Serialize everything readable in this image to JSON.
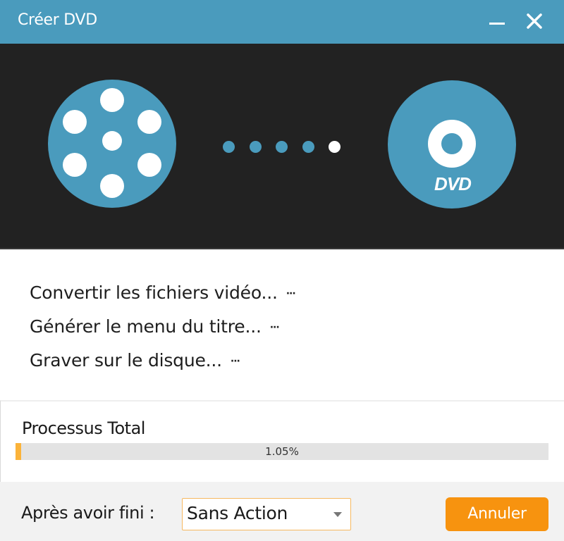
{
  "window": {
    "title": "Créer DVD",
    "controls": {
      "minimize_icon": "minimize-icon",
      "close_icon": "close-icon"
    }
  },
  "banner": {
    "source_icon": "film-reel-icon",
    "target_icon": "dvd-disc-icon",
    "target_icon_label": "DVD",
    "progress_dots": {
      "total": 5,
      "active_index": 4
    },
    "colors": {
      "accent": "#4a9bbd",
      "background": "#222222",
      "active_dot": "#ffffff"
    }
  },
  "steps": [
    {
      "label": "Convertir les fichiers vidéo...",
      "status": "···"
    },
    {
      "label": "Générer le menu du titre...",
      "status": "···"
    },
    {
      "label": "Graver sur le disque...",
      "status": "···"
    }
  ],
  "process": {
    "title": "Processus Total",
    "progress_percent": 1.05,
    "progress_text": "1.05%",
    "fill_color": "#fbb33a"
  },
  "footer": {
    "after_label": "Après avoir fini :",
    "after_select": {
      "value": "Sans Action"
    },
    "cancel_label": "Annuler",
    "cancel_color": "#f7930f"
  }
}
